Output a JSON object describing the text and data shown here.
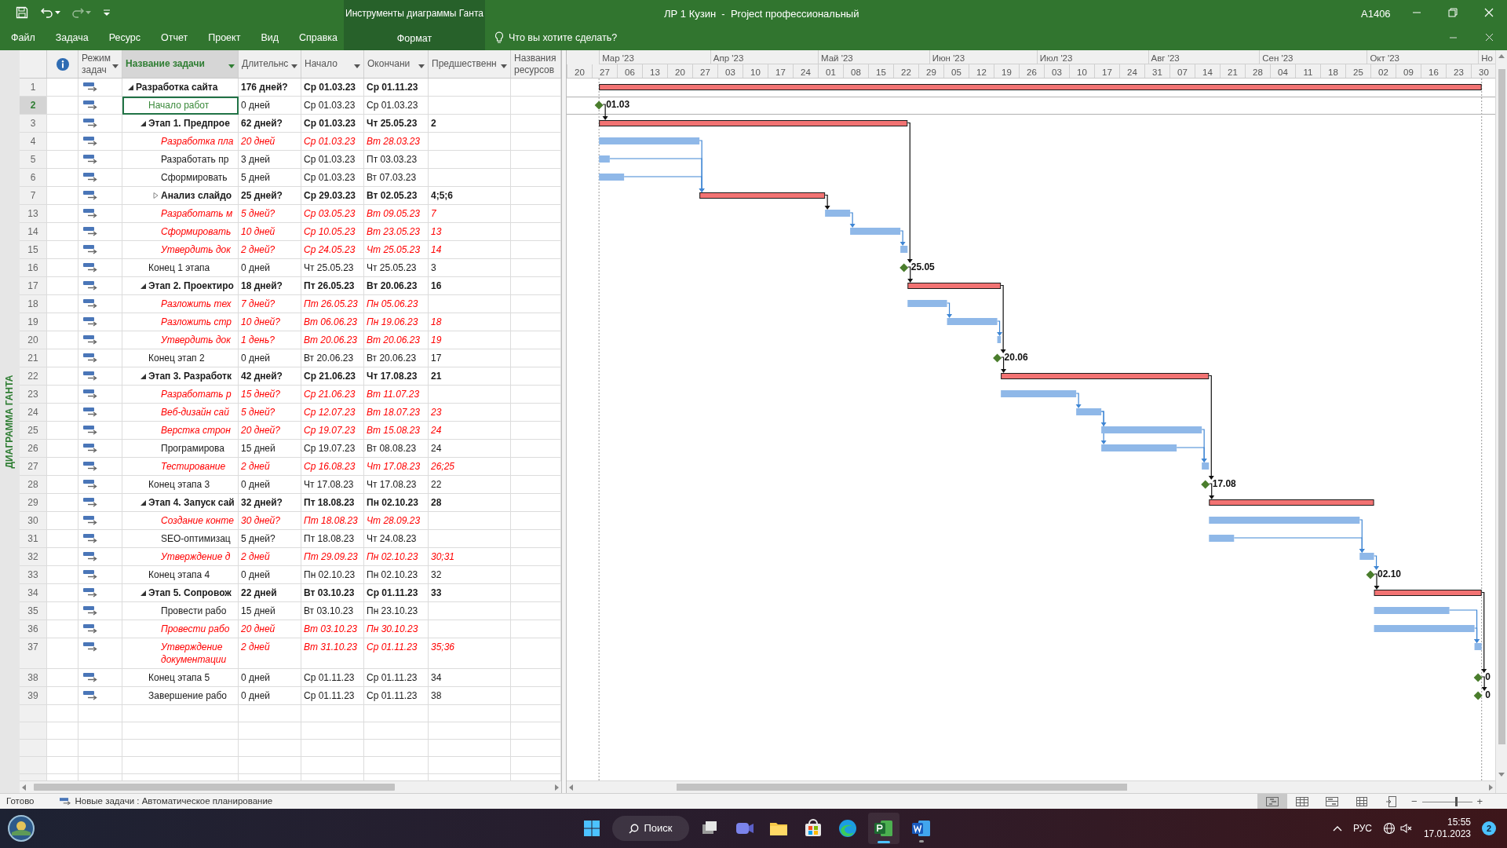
{
  "title_bar": {
    "title": "ЛР 1 Кузин  -  Project профессиональный",
    "user": "А1406"
  },
  "ribbon": {
    "tabs": [
      {
        "label": "Файл",
        "selected": false
      },
      {
        "label": "Задача",
        "selected": false
      },
      {
        "label": "Ресурс",
        "selected": false
      },
      {
        "label": "Отчет",
        "selected": false
      },
      {
        "label": "Проект",
        "selected": false
      },
      {
        "label": "Вид",
        "selected": false
      },
      {
        "label": "Справка",
        "selected": false
      }
    ],
    "context_group": {
      "label": "Инструменты диаграммы Ганта",
      "tabs": [
        {
          "label": "Формат",
          "selected": false
        }
      ]
    },
    "tell_me": "Что вы хотите сделать?"
  },
  "view_bar": "ДИАГРАММА ГАНТА",
  "table": {
    "columns": [
      {
        "kind": "info"
      },
      {
        "kind": "text",
        "label": "Режим задач",
        "filter": true,
        "selected": false
      },
      {
        "kind": "text",
        "label": "Название задачи",
        "filter": true,
        "selected": true
      },
      {
        "kind": "text",
        "label": "Длительнс",
        "filter": true,
        "selected": false
      },
      {
        "kind": "text",
        "label": "Начало",
        "filter": true,
        "selected": false
      },
      {
        "kind": "text",
        "label": "Окончани",
        "filter": true,
        "selected": false
      },
      {
        "kind": "text",
        "label": "Предшественн",
        "filter": true,
        "selected": false
      },
      {
        "kind": "text",
        "label": "Названия ресурсов",
        "filter": false,
        "selected": false
      }
    ],
    "rows": [
      {
        "id": "1",
        "kind": "summary",
        "name": "Разработка сайта",
        "duration": "176 дней?",
        "start": "Ср 01.03.23",
        "finish": "Ср 01.11.23",
        "critical": false,
        "selected": false,
        "expanded": true,
        "children": [
          {
            "id": "2",
            "kind": "milestone",
            "name": "Начало работ",
            "duration": "0 дней",
            "start": "Ср 01.03.23",
            "finish": "Ср 01.03.23",
            "critical": false,
            "selected": true,
            "bar_label": "01.03"
          },
          {
            "id": "3",
            "kind": "summary",
            "name": "Этап 1. Предпрое",
            "duration": "62 дней?",
            "start": "Ср 01.03.23",
            "finish": "Чт 25.05.23",
            "predecessors": "2",
            "critical": false,
            "selected": false,
            "expanded": true,
            "children": [
              {
                "id": "4",
                "kind": "task",
                "name": "Разработка пла",
                "duration": "20 дней",
                "start": "Ср 01.03.23",
                "finish": "Вт 28.03.23",
                "critical": true,
                "selected": false
              },
              {
                "id": "5",
                "kind": "task",
                "name": "Разработать пр",
                "duration": "3 дней",
                "start": "Ср 01.03.23",
                "finish": "Пт 03.03.23",
                "critical": false,
                "selected": false
              },
              {
                "id": "6",
                "kind": "task",
                "name": "Сформировать",
                "duration": "5 дней",
                "start": "Ср 01.03.23",
                "finish": "Вт 07.03.23",
                "critical": false,
                "selected": false
              },
              {
                "id": "7",
                "kind": "summary",
                "name": "Анализ слайдо",
                "duration": "25 дней?",
                "start": "Ср 29.03.23",
                "finish": "Вт 02.05.23",
                "predecessors": "4;5;6",
                "critical": false,
                "selected": false,
                "expanded": false
              },
              {
                "id": "13",
                "kind": "task",
                "name": "Разработать м",
                "duration": "5 дней?",
                "start": "Ср 03.05.23",
                "finish": "Вт 09.05.23",
                "predecessors": "7",
                "critical": true,
                "selected": false
              },
              {
                "id": "14",
                "kind": "task",
                "name": "Сформировать",
                "duration": "10 дней",
                "start": "Ср 10.05.23",
                "finish": "Вт 23.05.23",
                "predecessors": "13",
                "critical": true,
                "selected": false
              },
              {
                "id": "15",
                "kind": "task",
                "name": "Утвердить док",
                "duration": "2 дней?",
                "start": "Ср 24.05.23",
                "finish": "Чт 25.05.23",
                "predecessors": "14",
                "critical": true,
                "selected": false
              }
            ]
          },
          {
            "id": "16",
            "kind": "milestone",
            "name": "Конец 1 этапа",
            "duration": "0 дней",
            "start": "Чт 25.05.23",
            "finish": "Чт 25.05.23",
            "predecessors": "3",
            "critical": false,
            "selected": false,
            "bar_label": "25.05"
          },
          {
            "id": "17",
            "kind": "summary",
            "name": "Этап 2. Проектиро",
            "duration": "18 дней?",
            "start": "Пт 26.05.23",
            "finish": "Вт 20.06.23",
            "predecessors": "16",
            "critical": false,
            "selected": false,
            "expanded": true,
            "children": [
              {
                "id": "18",
                "kind": "task",
                "name": "Разложить тех",
                "duration": "7 дней?",
                "start": "Пт 26.05.23",
                "finish": "Пн 05.06.23",
                "critical": true,
                "selected": false
              },
              {
                "id": "19",
                "kind": "task",
                "name": "Разложить стр",
                "duration": "10 дней?",
                "start": "Вт 06.06.23",
                "finish": "Пн 19.06.23",
                "predecessors": "18",
                "critical": true,
                "selected": false
              },
              {
                "id": "20",
                "kind": "task",
                "name": "Утвердить док",
                "duration": "1 день?",
                "start": "Вт 20.06.23",
                "finish": "Вт 20.06.23",
                "predecessors": "19",
                "critical": true,
                "selected": false
              }
            ]
          },
          {
            "id": "21",
            "kind": "milestone",
            "name": "Конец этап 2",
            "duration": "0 дней",
            "start": "Вт 20.06.23",
            "finish": "Вт 20.06.23",
            "predecessors": "17",
            "critical": false,
            "selected": false,
            "bar_label": "20.06"
          },
          {
            "id": "22",
            "kind": "summary",
            "name": "Этап 3. Разработк",
            "duration": "42 дней?",
            "start": "Ср 21.06.23",
            "finish": "Чт 17.08.23",
            "predecessors": "21",
            "critical": false,
            "selected": false,
            "expanded": true,
            "children": [
              {
                "id": "23",
                "kind": "task",
                "name": "Разработать р",
                "duration": "15 дней?",
                "start": "Ср 21.06.23",
                "finish": "Вт 11.07.23",
                "critical": true,
                "selected": false
              },
              {
                "id": "24",
                "kind": "task",
                "name": "Веб-дизайн сай",
                "duration": "5 дней?",
                "start": "Ср 12.07.23",
                "finish": "Вт 18.07.23",
                "predecessors": "23",
                "critical": true,
                "selected": false
              },
              {
                "id": "25",
                "kind": "task",
                "name": "Верстка строн",
                "duration": "20 дней?",
                "start": "Ср 19.07.23",
                "finish": "Вт 15.08.23",
                "predecessors": "24",
                "critical": true,
                "selected": false
              },
              {
                "id": "26",
                "kind": "task",
                "name": "Програмирова",
                "duration": "15 дней",
                "start": "Ср 19.07.23",
                "finish": "Вт 08.08.23",
                "predecessors": "24",
                "critical": false,
                "selected": false
              },
              {
                "id": "27",
                "kind": "task",
                "name": "Тестирование",
                "duration": "2 дней",
                "start": "Ср 16.08.23",
                "finish": "Чт 17.08.23",
                "predecessors": "26;25",
                "critical": true,
                "selected": false
              }
            ]
          },
          {
            "id": "28",
            "kind": "milestone",
            "name": "Конец этапа 3",
            "duration": "0 дней",
            "start": "Чт 17.08.23",
            "finish": "Чт 17.08.23",
            "predecessors": "22",
            "critical": false,
            "selected": false,
            "bar_label": "17.08"
          },
          {
            "id": "29",
            "kind": "summary",
            "name": "Этап 4. Запуск сай",
            "duration": "32 дней?",
            "start": "Пт 18.08.23",
            "finish": "Пн 02.10.23",
            "predecessors": "28",
            "critical": false,
            "selected": false,
            "expanded": true,
            "children": [
              {
                "id": "30",
                "kind": "task",
                "name": "Создание конте",
                "duration": "30 дней?",
                "start": "Пт 18.08.23",
                "finish": "Чт 28.09.23",
                "critical": true,
                "selected": false
              },
              {
                "id": "31",
                "kind": "task",
                "name": "SEO-оптимизац",
                "duration": "5 дней?",
                "start": "Пт 18.08.23",
                "finish": "Чт 24.08.23",
                "critical": false,
                "selected": false
              },
              {
                "id": "32",
                "kind": "task",
                "name": "Утверждение д",
                "duration": "2 дней",
                "start": "Пт 29.09.23",
                "finish": "Пн 02.10.23",
                "predecessors": "30;31",
                "critical": true,
                "selected": false
              }
            ]
          },
          {
            "id": "33",
            "kind": "milestone",
            "name": "Конец этапа 4",
            "duration": "0 дней",
            "start": "Пн 02.10.23",
            "finish": "Пн 02.10.23",
            "predecessors": "32",
            "critical": false,
            "selected": false,
            "bar_label": "02.10"
          },
          {
            "id": "34",
            "kind": "summary",
            "name": "Этап 5. Сопровож",
            "duration": "22 дней",
            "start": "Вт 03.10.23",
            "finish": "Ср 01.11.23",
            "predecessors": "33",
            "critical": false,
            "selected": false,
            "expanded": true,
            "children": [
              {
                "id": "35",
                "kind": "task",
                "name": "Провести рабо",
                "duration": "15 дней",
                "start": "Вт 03.10.23",
                "finish": "Пн 23.10.23",
                "critical": false,
                "selected": false
              },
              {
                "id": "36",
                "kind": "task",
                "name": "Провести рабо",
                "duration": "20 дней",
                "start": "Вт 03.10.23",
                "finish": "Пн 30.10.23",
                "critical": true,
                "selected": false
              },
              {
                "id": "37",
                "kind": "task",
                "name": "Утверждение документации",
                "duration": "2 дней",
                "start": "Вт 31.10.23",
                "finish": "Ср 01.11.23",
                "predecessors": "35;36",
                "critical": true,
                "selected": false
              }
            ]
          },
          {
            "id": "38",
            "kind": "milestone",
            "name": "Конец этапа 5",
            "duration": "0 дней",
            "start": "Ср 01.11.23",
            "finish": "Ср 01.11.23",
            "predecessors": "34",
            "critical": false,
            "selected": false,
            "bar_label": "0"
          },
          {
            "id": "39",
            "kind": "milestone",
            "name": "Завершение рабо",
            "duration": "0 дней",
            "start": "Ср 01.11.23",
            "finish": "Ср 01.11.23",
            "predecessors": "38",
            "critical": false,
            "selected": false,
            "bar_label": "0"
          }
        ]
      }
    ]
  },
  "timescale": {
    "months": [
      "Мар '23",
      "Апр '23",
      "Май '23",
      "Июн '23",
      "Июл '23",
      "Авг '23",
      "Сен '23",
      "Окт '23",
      "Но"
    ],
    "weeks": [
      "20",
      "27",
      "06",
      "13",
      "20",
      "27",
      "03",
      "10",
      "17",
      "24",
      "01",
      "08",
      "15",
      "22",
      "29",
      "05",
      "12",
      "19",
      "26",
      "03",
      "10",
      "17",
      "24",
      "31",
      "07",
      "14",
      "21",
      "28",
      "04",
      "11",
      "18",
      "25",
      "02",
      "09",
      "16",
      "23",
      "30"
    ]
  },
  "status_bar": {
    "status": "Готово",
    "new_tasks": "Новые задачи : Автоматическое планирование",
    "views": [
      {
        "kind": "gantt",
        "selected": true
      },
      {
        "kind": "sheet",
        "selected": false
      },
      {
        "kind": "split",
        "selected": false
      },
      {
        "kind": "grid",
        "selected": false
      },
      {
        "kind": "report",
        "selected": false
      }
    ],
    "zoom": {
      "minus": "−",
      "plus": "+",
      "level": 0.68
    }
  },
  "taskbar": {
    "search": "Поиск",
    "language": "РУС",
    "time": "15:55",
    "date": "17.01.2023",
    "notifications": "2"
  }
}
